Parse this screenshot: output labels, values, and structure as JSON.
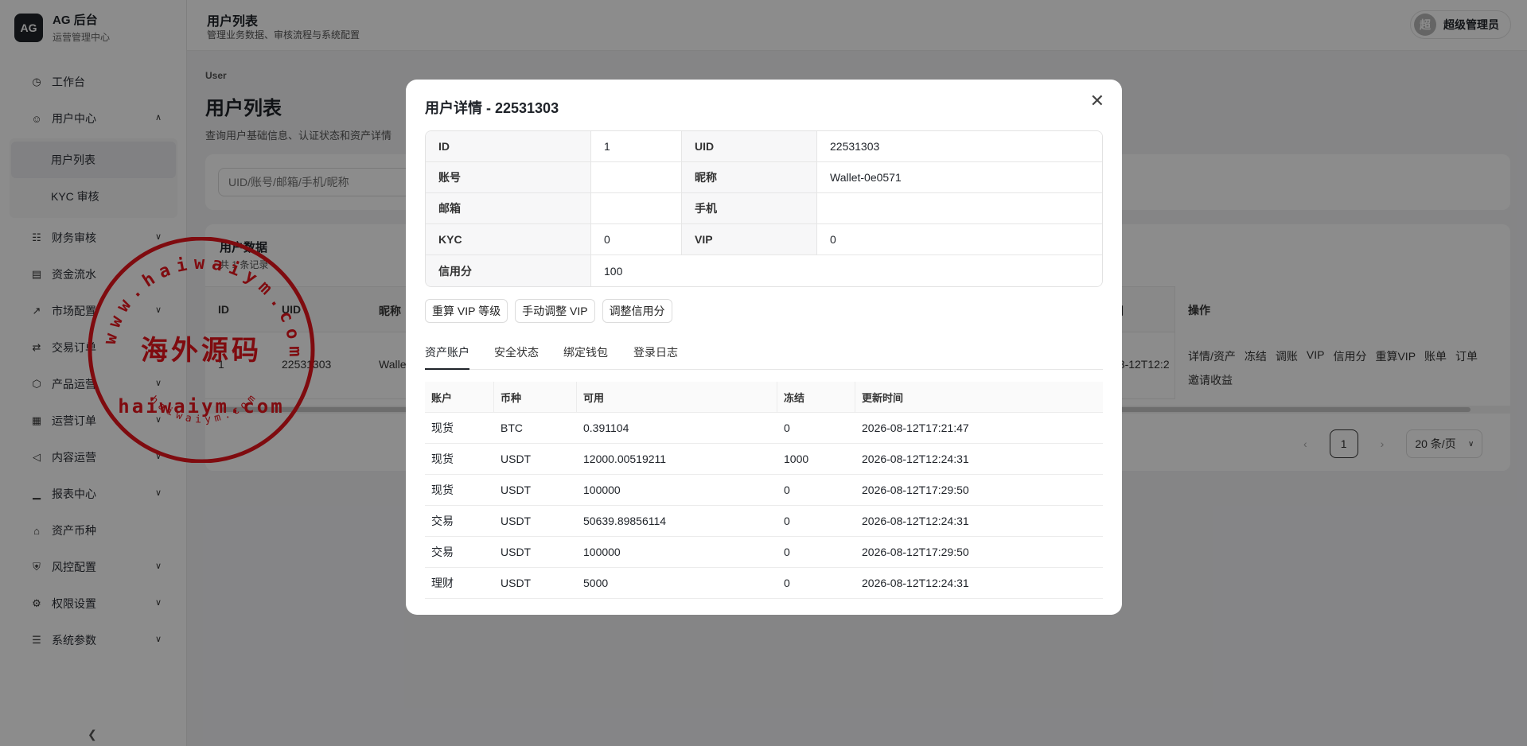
{
  "brand": {
    "logo": "AG",
    "title": "AG 后台",
    "subtitle": "运营管理中心"
  },
  "sidebar": {
    "items": [
      {
        "label": "工作台",
        "icon": "dashboard-icon",
        "expandable": false
      },
      {
        "label": "用户中心",
        "icon": "users-icon",
        "expandable": true,
        "expanded": true,
        "children": [
          {
            "label": "用户列表",
            "active": true
          },
          {
            "label": "KYC 审核",
            "active": false
          }
        ]
      },
      {
        "label": "财务审核",
        "icon": "finance-audit-icon",
        "expandable": true
      },
      {
        "label": "资金流水",
        "icon": "ledger-icon",
        "expandable": false
      },
      {
        "label": "市场配置",
        "icon": "chart-line-icon",
        "expandable": true
      },
      {
        "label": "交易订单",
        "icon": "swap-icon",
        "expandable": true
      },
      {
        "label": "产品运营",
        "icon": "box-icon",
        "expandable": true
      },
      {
        "label": "运营订单",
        "icon": "orders-icon",
        "expandable": true
      },
      {
        "label": "内容运营",
        "icon": "megaphone-icon",
        "expandable": true
      },
      {
        "label": "报表中心",
        "icon": "bar-chart-icon",
        "expandable": true
      },
      {
        "label": "资产币种",
        "icon": "bank-icon",
        "expandable": false
      },
      {
        "label": "风控配置",
        "icon": "shield-icon",
        "expandable": true
      },
      {
        "label": "权限设置",
        "icon": "gear-icon",
        "expandable": true
      },
      {
        "label": "系统参数",
        "icon": "document-icon",
        "expandable": true
      }
    ],
    "collapse_icon": "chevron-left-icon"
  },
  "header": {
    "title": "用户列表",
    "subtitle": "管理业务数据、审核流程与系统配置",
    "user_avatar": "超",
    "user_name": "超级管理员"
  },
  "page": {
    "breadcrumb": "User",
    "title": "用户列表",
    "description": "查询用户基础信息、认证状态和资产详情",
    "search_placeholder": "UID/账号/邮箱/手机/昵称"
  },
  "table": {
    "title": "用户数据",
    "count": "共 1 条记录",
    "columns": [
      "ID",
      "UID",
      "昵称",
      "间",
      "操作"
    ],
    "rows": [
      {
        "id": "1",
        "uid": "22531303",
        "nickname": "Walle",
        "time": "08-12T12:2"
      }
    ],
    "actions": [
      "详情/资产",
      "冻结",
      "调账",
      "VIP",
      "信用分",
      "重算VIP",
      "账单",
      "订单",
      "邀请收益"
    ]
  },
  "pagination": {
    "prev": "‹",
    "current": "1",
    "next": "›",
    "page_size": "20 条/页"
  },
  "modal": {
    "title": "用户详情 - 22531303",
    "close_icon": "close-icon",
    "fields": {
      "id_label": "ID",
      "id_value": "1",
      "uid_label": "UID",
      "uid_value": "22531303",
      "account_label": "账号",
      "account_value": "",
      "nickname_label": "昵称",
      "nickname_value": "Wallet-0e0571",
      "email_label": "邮箱",
      "email_value": "",
      "phone_label": "手机",
      "phone_value": "",
      "kyc_label": "KYC",
      "kyc_value": "0",
      "vip_label": "VIP",
      "vip_value": "0",
      "credit_label": "信用分",
      "credit_value": "100"
    },
    "buttons": [
      "重算 VIP 等级",
      "手动调整 VIP",
      "调整信用分"
    ],
    "tabs": [
      {
        "label": "资产账户",
        "active": true
      },
      {
        "label": "安全状态",
        "active": false
      },
      {
        "label": "绑定钱包",
        "active": false
      },
      {
        "label": "登录日志",
        "active": false
      }
    ],
    "assets": {
      "columns": [
        "账户",
        "币种",
        "可用",
        "冻结",
        "更新时间"
      ],
      "rows": [
        [
          "现货",
          "BTC",
          "0.391104",
          "0",
          "2026-08-12T17:21:47"
        ],
        [
          "现货",
          "USDT",
          "12000.00519211",
          "1000",
          "2026-08-12T12:24:31"
        ],
        [
          "现货",
          "USDT",
          "100000",
          "0",
          "2026-08-12T17:29:50"
        ],
        [
          "交易",
          "USDT",
          "50639.89856114",
          "0",
          "2026-08-12T12:24:31"
        ],
        [
          "交易",
          "USDT",
          "100000",
          "0",
          "2026-08-12T17:29:50"
        ],
        [
          "理财",
          "USDT",
          "5000",
          "0",
          "2026-08-12T12:24:31"
        ]
      ]
    }
  },
  "watermark": {
    "top_arc": "www.haiwaiym.com",
    "center": "海外源码",
    "domain": "haiwaiym.com",
    "bottom_arc": "haiwaiym.com",
    "color": "#e8141c"
  }
}
